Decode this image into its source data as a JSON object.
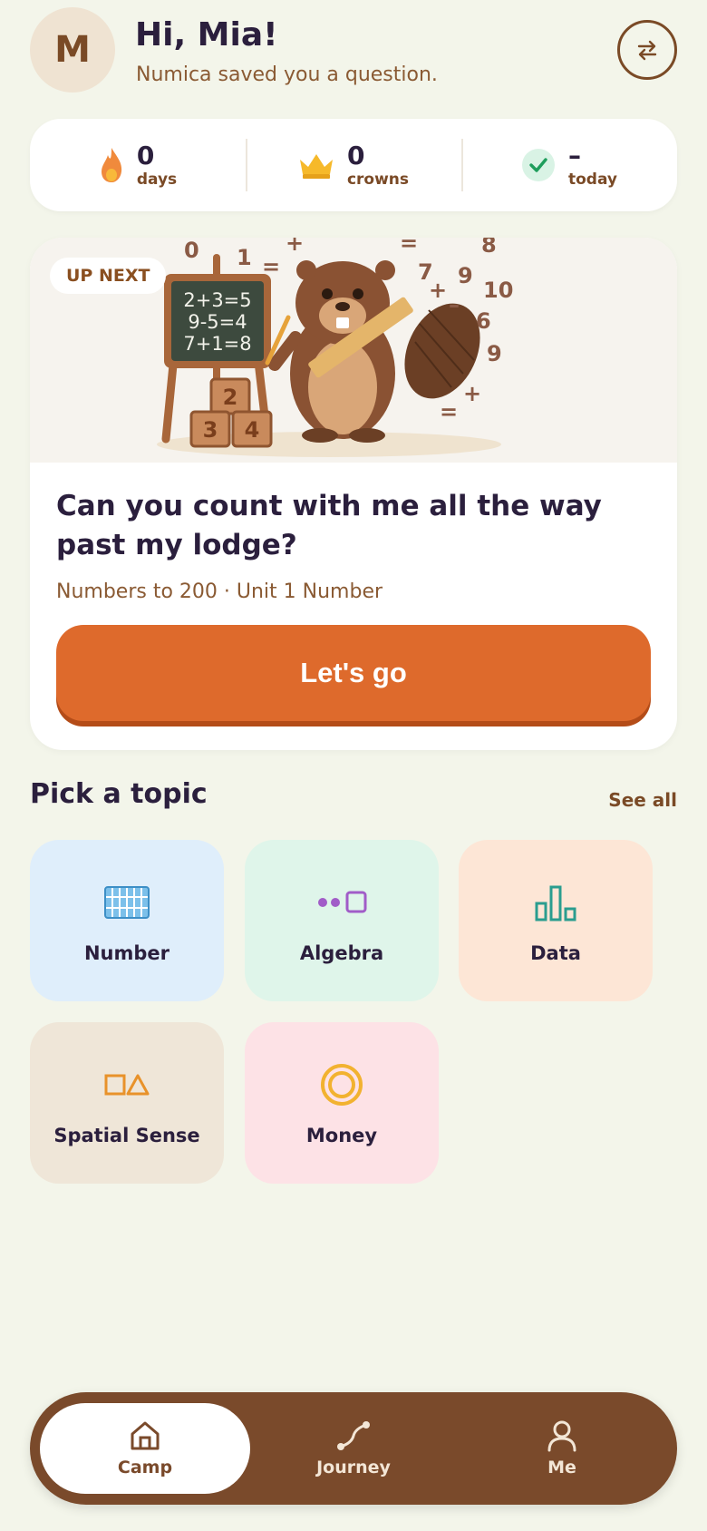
{
  "header": {
    "avatar_initial": "M",
    "greeting": "Hi, Mia!",
    "subtitle": "Numica saved you a question."
  },
  "stats": [
    {
      "value": "0",
      "label": "days",
      "icon": "flame-icon"
    },
    {
      "value": "0",
      "label": "crowns",
      "icon": "crown-icon"
    },
    {
      "value": "–",
      "label": "today",
      "icon": "check-icon"
    }
  ],
  "next": {
    "pill": "UP NEXT",
    "title": "Can you count with me all the way past my lodge?",
    "meta": "Numbers to 200 · Unit 1 Number",
    "button": "Let's go",
    "illustration": {
      "chalkboard": [
        "2+3=5",
        "9-5=4",
        "7+1=8"
      ],
      "blocks": [
        "2",
        "3",
        "4"
      ],
      "floating": [
        "0",
        "1",
        "=",
        "+",
        "=",
        "8",
        "7",
        "9",
        "10",
        "+",
        "–",
        "6",
        "9",
        "+",
        "="
      ]
    }
  },
  "topics": {
    "title": "Pick a topic",
    "see_all": "See all",
    "items": [
      {
        "label": "Number",
        "icon": "grid-icon",
        "bg": "#dfeefb"
      },
      {
        "label": "Algebra",
        "icon": "pattern-icon",
        "bg": "#dff5ea"
      },
      {
        "label": "Data",
        "icon": "bar-chart-icon",
        "bg": "#fde6d6"
      },
      {
        "label": "Spatial Sense",
        "icon": "shapes-icon",
        "bg": "#efe6d8"
      },
      {
        "label": "Money",
        "icon": "coin-icon",
        "bg": "#fde2e6"
      }
    ]
  },
  "nav": [
    {
      "label": "Camp",
      "icon": "home-icon",
      "active": true
    },
    {
      "label": "Journey",
      "icon": "path-icon",
      "active": false
    },
    {
      "label": "Me",
      "icon": "person-icon",
      "active": false
    }
  ],
  "colors": {
    "background": "#f3f5ea",
    "accent": "#de6a2c",
    "brown": "#7a4a2b",
    "ink": "#2b1f3d"
  }
}
